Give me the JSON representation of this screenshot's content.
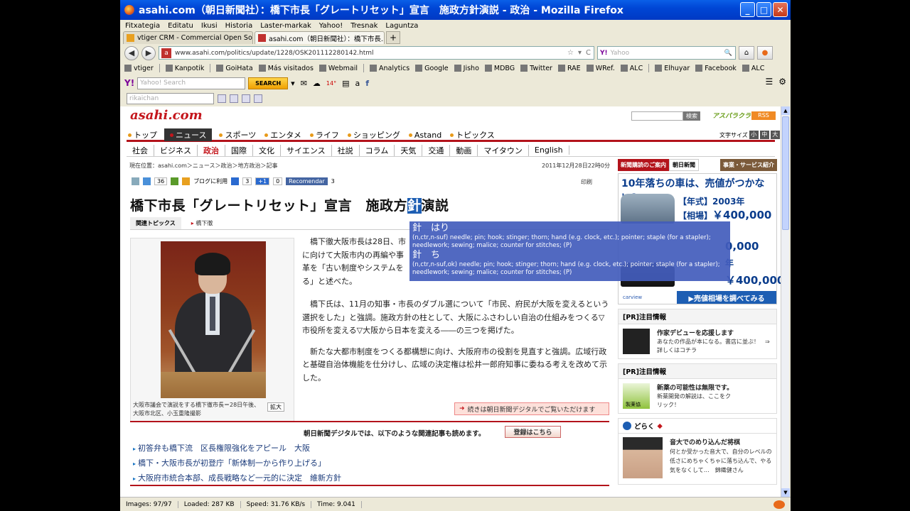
{
  "window": {
    "title": "asahi.com（朝日新聞社）：橋下市長「グレートリセット」宣言　施政方針演説 - 政治 - Mozilla Firefox",
    "minimize": "_",
    "maximize": "□",
    "close": "✕"
  },
  "menu": [
    "Fitxategia",
    "Editatu",
    "Ikusi",
    "Historia",
    "Laster-markak",
    "Yahoo!",
    "Tresnak",
    "Laguntza"
  ],
  "tabs": [
    {
      "label": "vtiger CRM - Commercial Open So...",
      "close": "✕"
    },
    {
      "label": "asahi.com（朝日新聞社）：橋下市長...",
      "close": "✕"
    }
  ],
  "newtab": "+",
  "nav": {
    "back": "◀",
    "forward": "▶",
    "url": "www.asahi.com/politics/update/1228/OSK201112280142.html",
    "url_icons": [
      "☆",
      "▾",
      "C"
    ],
    "search_engine": "Y!",
    "search_placeholder": "Yahoo",
    "search_icon": "🔍",
    "home": "⌂",
    "addon": "●"
  },
  "bookmarks": [
    "vtiger",
    "Kanpotik",
    "GoiHata",
    "Más visitados",
    "Webmail",
    "Analytics",
    "Google",
    "Jisho",
    "MDBG",
    "Twitter",
    "RAE",
    "WRef.",
    "ALC",
    "Elhuyar",
    "Facebook",
    "ALC"
  ],
  "yahoo_toolbar": {
    "logo": "Y!",
    "placeholder": "Yahoo! Search",
    "search_btn": "SEARCH",
    "weather": "14°",
    "tools": [
      "▾",
      "✉",
      "☁",
      "▤",
      "a",
      "f"
    ]
  },
  "rikai": {
    "placeholder": "rikaichan"
  },
  "page": {
    "logo": "asahi.com",
    "site_search_btn": "検索",
    "asapara": "アスパラクラブ",
    "rss": "RSS",
    "global_nav": [
      "トップ",
      "ニュース",
      "スポーツ",
      "エンタメ",
      "ライフ",
      "ショッピング",
      "Astand",
      "トピックス"
    ],
    "font_size_label": "文字サイズ",
    "font_sizes": [
      "小",
      "中",
      "大"
    ],
    "sub_nav": [
      "社会",
      "ビジネス",
      "政治",
      "国際",
      "文化",
      "サイエンス",
      "社説",
      "コラム",
      "天気",
      "交通",
      "動画",
      "マイタウン",
      "English"
    ],
    "breadcrumb": "現在位置：asahi.com＞ニュース＞政治＞地方政治＞記事",
    "date": "2011年12月28日22時0分",
    "share": {
      "count1": "36",
      "blog": "ブログに利用",
      "count2": "3",
      "plus": "+1",
      "count3": "0",
      "recommend": "Recomendar",
      "count4": "3",
      "print": "印刷"
    },
    "headline_pre": "橋下市長「グレートリセット」宣言　施政方",
    "headline_hl": "針",
    "headline_post": "演説",
    "related_label": "関連トピックス",
    "related_tag": "橋下徹",
    "caption": "大阪市議会で演説をする橋下徹市長＝28日午後、大阪市北区、小玉重隆撮影",
    "zoom": "拡大",
    "paragraphs": [
      "橋下徹大阪市長は28日、市",
      "に向けて大阪市内の再編や事",
      "革を「古い制度やシステムを",
      "る」と述べた。",
      "橋下氏は、11月の知事・市長のダブル選について「市民、府民が大阪を変えるという選択をした」と強調。施政方針の柱として、大阪にふさわしい自治の仕組みをつくる▽市役所を変える▽大阪から日本を変える――の三つを掲げた。",
      "新たな大都市制度をつくる都構想に向け、大阪府市の役割を見直すと強調。広域行政と基礎自治体機能を仕分けし、広域の決定権は松井一郎府知事に委ねる考えを改めて示した。"
    ],
    "continue": "続きは朝日新聞デジタルでご覧いただけます",
    "related_head": "朝日新聞デジタルでは、以下のような関連記事も読めます。",
    "register_btn": "登録はこちら",
    "related_links": [
      "初答弁も橋下流　区長権限強化をアピール　大阪",
      "橋下・大阪市長が初登庁「新体制一から作り上げる」",
      "大阪府市統合本部、成長戦略など一元的に決定　維新方針"
    ]
  },
  "sidebar": {
    "adbar": [
      "新聞購読のご案内",
      "朝日新聞",
      "事業・サービス紹介"
    ],
    "car_title": "10年落ちの車は、売値がつかない?",
    "car_year_label": "【年式】",
    "car_year": "2003年",
    "car_price_label": "【相場】",
    "car_price": "￥400,000",
    "car_price_b": "0,000",
    "car_year_b": "年",
    "car_price_c": "￥400,000",
    "carview": "carview",
    "car_btn": "▶売値相場を調べてみる",
    "pr1_head": "[PR]注目情報",
    "pr1_title": "作家デビューを応援します",
    "pr1_desc": "あなたの作品が本になる。書店に並ぶ！　⇒詳しくはコチラ",
    "pr2_head": "[PR]注目情報",
    "pr2_title": "新薬の可能性は無限です。",
    "pr2_desc": "新薬開発の解説は、ここをクリック！",
    "pr2_thumb": "製薬協",
    "dokura_head": "どらく",
    "dokura_title": "音大でのめり込んだ将棋",
    "dokura_desc": "何とか受かった音大で、自分のレベルの低さにめちゃくちゃに落ち込んで、やる気をなくして…　錦織健さん"
  },
  "popup": {
    "k1": "針　はり",
    "d1": "(n,ctr,n-suf) needle; pin; hook; stinger; thorn; hand (e.g. clock, etc.); pointer; staple (for a stapler); needlework; sewing; malice; counter for stitches; (P)",
    "k2": "針　ち",
    "d2": "(n,ctr,n-suf,ok) needle; pin; hook; stinger; thorn; hand (e.g. clock, etc.); pointer; staple (for a stapler); needlework; sewing; malice; counter for stitches; (P)"
  },
  "status": {
    "images": "Images: 97/97",
    "loaded": "Loaded: 287 KB",
    "speed": "Speed: 31.76 KB/s",
    "time": "Time: 9.041"
  }
}
